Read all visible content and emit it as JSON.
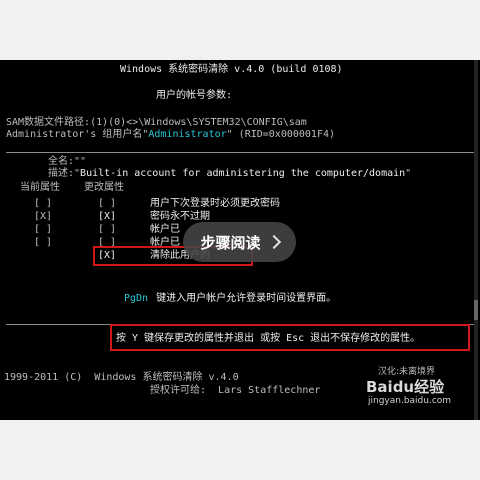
{
  "header": {
    "title": "Windows 系统密码清除 v.4.0 (build 0108)",
    "subtitle": "用户的帐号参数:"
  },
  "info": {
    "sam_path": "SAM数据文件路径:(1)(0)<>\\Windows\\SYSTEM32\\CONFIG\\sam",
    "group_prefix": "Administrator's 组用户名\"",
    "group_name": "Administrator",
    "rid": "\" (RID=0x000001F4)"
  },
  "account": {
    "fullname_line": "全名:\"\"",
    "desc_prefix": "描述:\"",
    "description": "Built-in account for administering the computer/domain",
    "desc_suffix": "\""
  },
  "columns": {
    "current": "当前属性",
    "changed": "更改属性"
  },
  "rows": [
    {
      "current": "[ ]",
      "changed": "[ ]",
      "label": "用户下次登录时必须更改密码"
    },
    {
      "current": "[X]",
      "changed": "[X]",
      "label": "密码永不过期"
    },
    {
      "current": "[ ]",
      "changed": "[ ]",
      "label": "帐户已"
    },
    {
      "current": "[ ]",
      "changed": "[ ]",
      "label": "帐户已"
    },
    {
      "current": "",
      "changed": "[X]",
      "label": "清除此用户的"
    }
  ],
  "pgdn": {
    "key": "PgDn",
    "text": "键进入用户帐户允许登录时间设置界面。"
  },
  "hint": {
    "text": "按 Y 键保存更改的属性并退出 或按 Esc 退出不保存修改的属性。"
  },
  "footer": {
    "copyright": "1999-2011 (C)  Windows 系统密码清除 v.4.0",
    "license": "授权许可给:  Lars Stafflechner"
  },
  "overlay": {
    "label": "步骤阅读"
  },
  "watermark": {
    "brand": "Baidu经验",
    "url": "jingyan.baidu.com",
    "faint": "汉化:未离境界"
  }
}
